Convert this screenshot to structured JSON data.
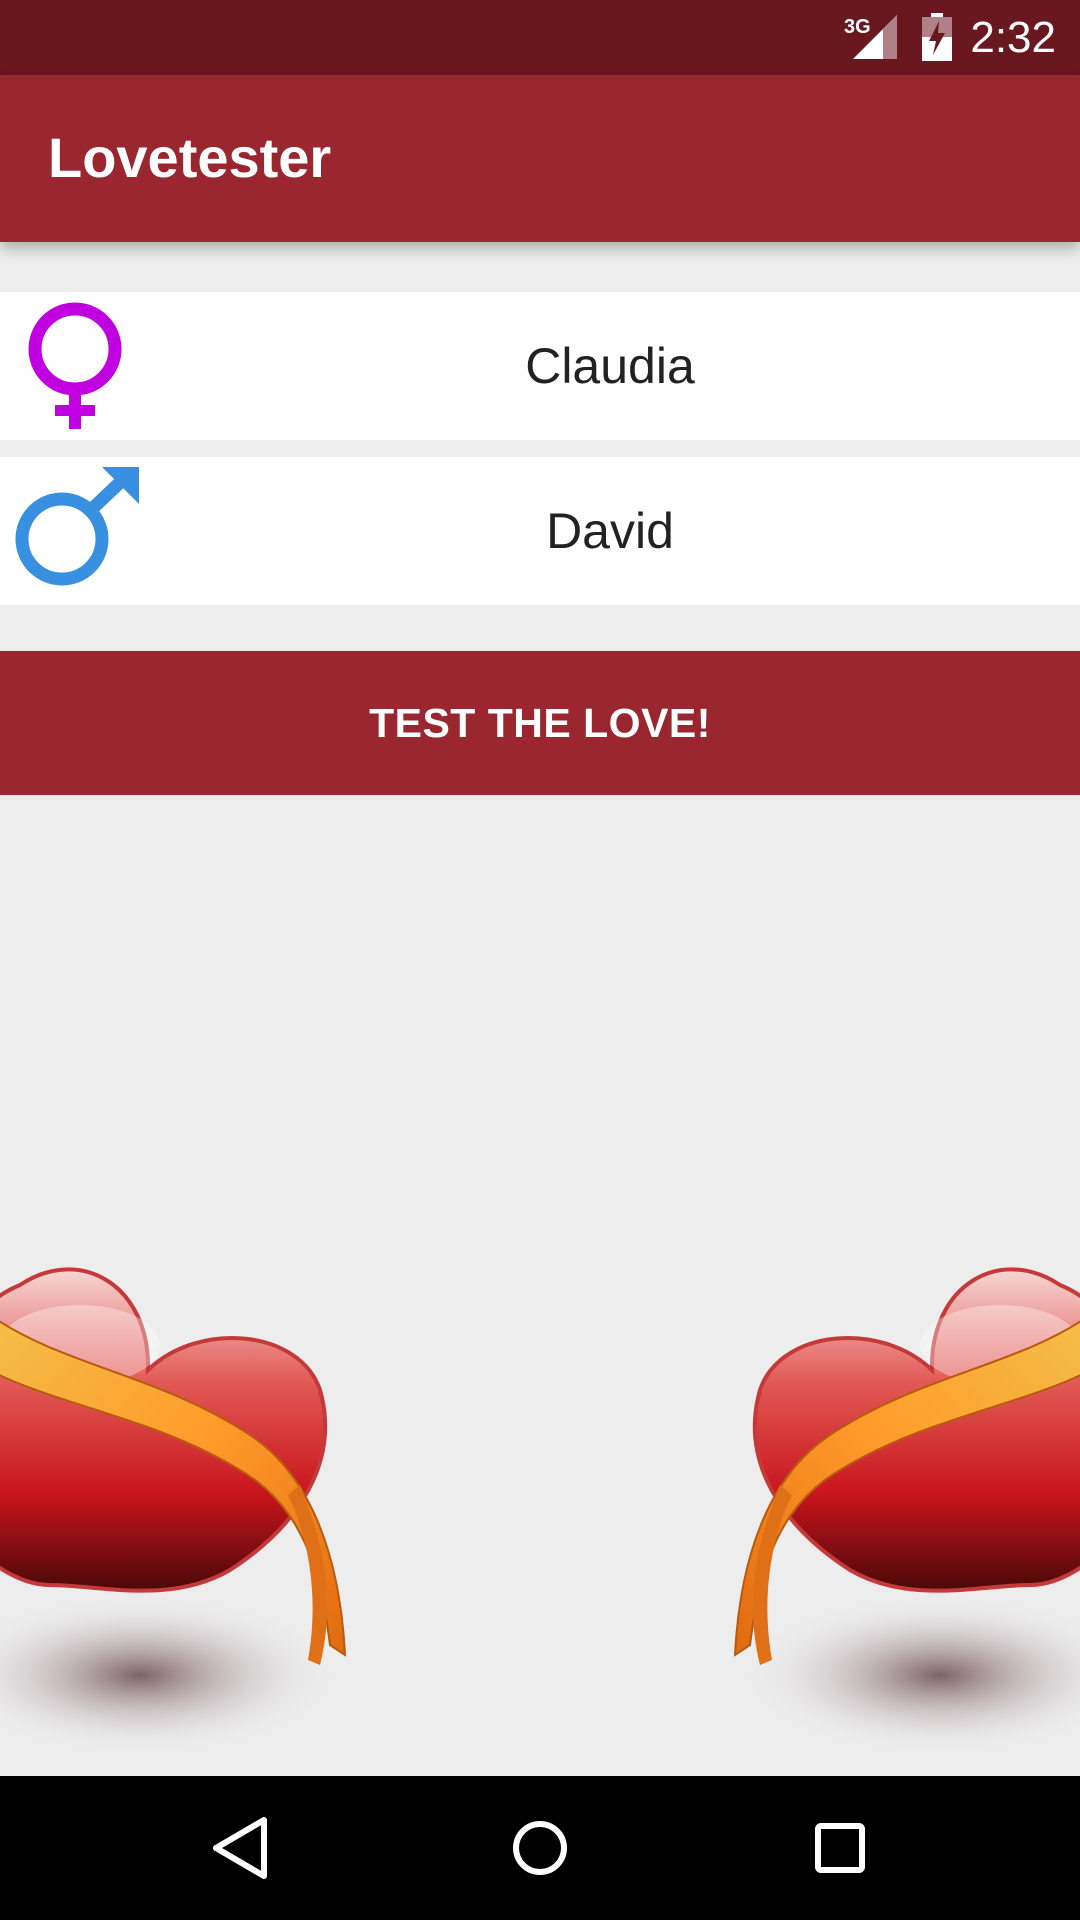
{
  "status_bar": {
    "network": "3G",
    "time": "2:32"
  },
  "app_bar": {
    "title": "Lovetester"
  },
  "inputs": {
    "female_name": "Claudia",
    "male_name": "David"
  },
  "icons": {
    "female": "female-symbol-icon",
    "male": "male-symbol-icon",
    "back": "back-triangle-icon",
    "home": "home-circle-icon",
    "recents": "recents-square-icon"
  },
  "action": {
    "label": "TEST THE LOVE!"
  },
  "colors": {
    "primary": "#9a2730",
    "primary_dark": "#6a1820",
    "female_symbol": "#c000e0",
    "male_symbol": "#3a90e0",
    "background": "#ededed"
  }
}
